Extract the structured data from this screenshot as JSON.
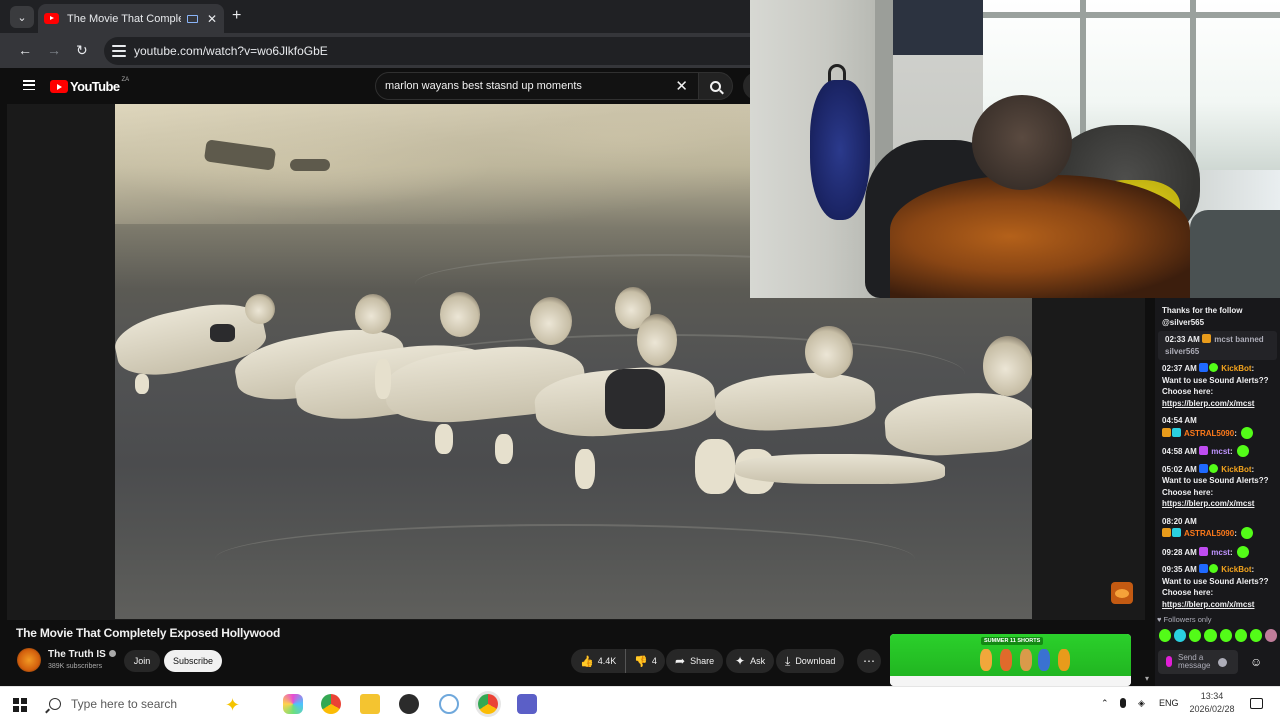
{
  "browser": {
    "tab_title": "The Movie That Completely Exposed Hollywood",
    "url": "youtube.com/watch?v=wo6JlkfoGbE",
    "new_tab_symbol": "+",
    "close_symbol": "✕",
    "back_symbol": "←",
    "forward_symbol": "→",
    "reload_symbol": "↻",
    "tab_menu_symbol": "⌄"
  },
  "youtube": {
    "logo_text": "YouTube",
    "country": "ZA",
    "search_query": "marlon wayans best stasnd up moments",
    "search_clear_symbol": "✕"
  },
  "video": {
    "title": "The Movie That Completely Exposed Hollywood",
    "channel_name": "The Truth IS",
    "subscribers": "389K subscribers",
    "join_label": "Join",
    "subscribe_label": "Subscribe",
    "likes": "4.4K",
    "dislikes": "4",
    "share_label": "Share",
    "ask_label": "Ask",
    "download_label": "Download",
    "more_symbol": "⋯",
    "like_icon": "👍",
    "dislike_icon": "👎",
    "share_icon": "➦",
    "ask_icon": "✦",
    "download_icon": "⤓"
  },
  "chat": {
    "messages": [
      {
        "text": "Thanks for the follow @silver565"
      },
      {
        "time": "02:33 AM",
        "user": "mcst",
        "action": "banned silver565"
      },
      {
        "time": "02:37 AM",
        "user": "KickBot",
        "text": "Want to use Sound Alerts?? Choose here:",
        "link": "https://blerp.com/x/mcst"
      },
      {
        "time": "04:54 AM",
        "user": "ASTRAL5090"
      },
      {
        "time": "04:58 AM",
        "user": "mcst"
      },
      {
        "time": "05:02 AM",
        "user": "KickBot",
        "text": "Want to use Sound Alerts?? Choose here:",
        "link": "https://blerp.com/x/mcst"
      },
      {
        "time": "08:20 AM",
        "user": "ASTRAL5090"
      },
      {
        "time": "09:28 AM",
        "user": "mcst"
      },
      {
        "time": "09:35 AM",
        "user": "KickBot",
        "text": "Want to use Sound Alerts?? Choose here:",
        "link": "https://blerp.com/x/mcst"
      }
    ],
    "colon": ":",
    "followers_only": "Followers only",
    "input_placeholder": "Send a message",
    "emoji_button": "☺"
  },
  "ad": {
    "label": "SUMMER 11 SHORTS"
  },
  "taskbar": {
    "search_placeholder": "Type here to search",
    "language": "ENG",
    "time": "13:34",
    "date": "2026/02/28",
    "chevron_up": "⌃"
  },
  "colors": {
    "youtube_red": "#ff0000",
    "kick_green": "#53fc18",
    "chrome_dark": "#202124"
  }
}
